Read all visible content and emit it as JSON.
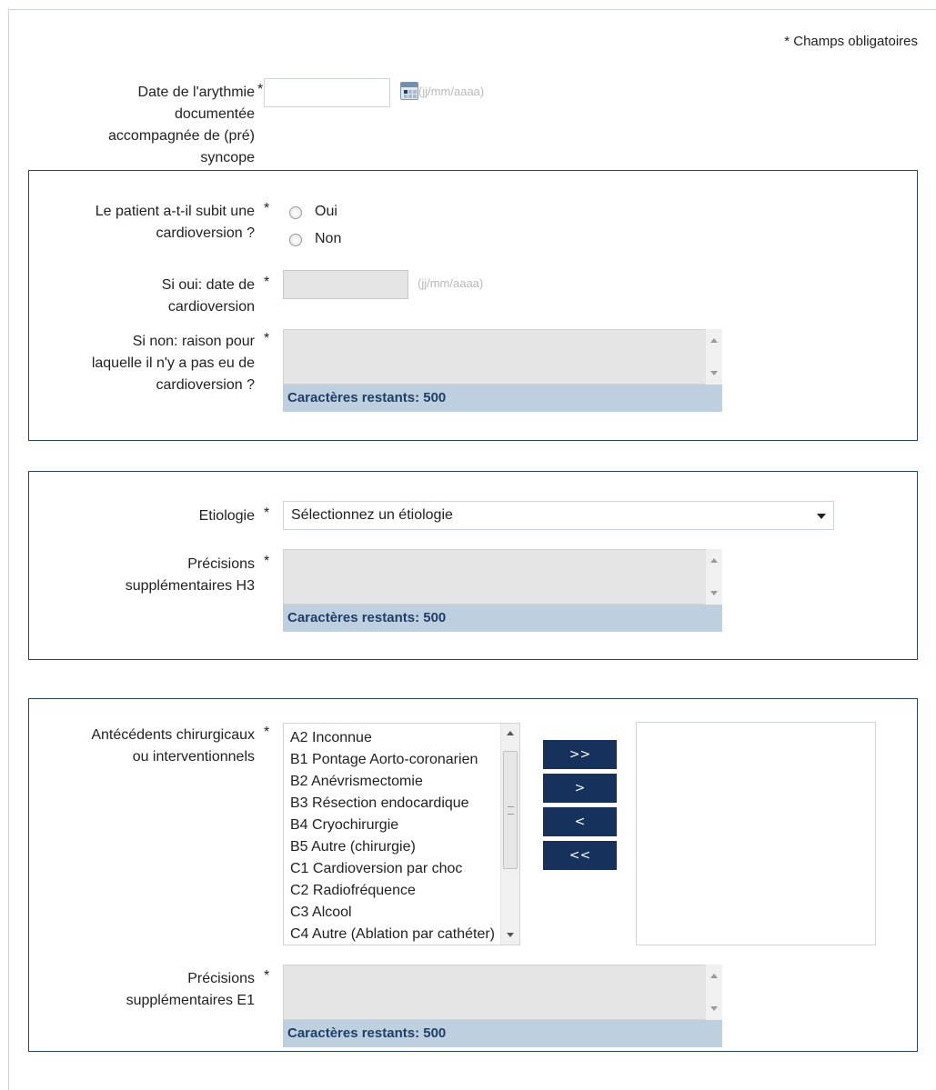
{
  "required_note": "* Champs obligatoires",
  "date_format_hint": "(jj/mm/aaaa)",
  "chars_remaining": "Caractères restants: 500",
  "arrhythmia_date": {
    "label_lines": [
      "Date de l'arythmie",
      "documentée",
      "accompagnée de (pré)",
      "syncope"
    ],
    "value": ""
  },
  "cardioversion": {
    "question_lines": [
      "Le patient a-t-il subit une",
      "cardioversion ?"
    ],
    "options": [
      "Oui",
      "Non"
    ],
    "date_label_lines": [
      "Si oui: date de",
      "cardioversion"
    ],
    "reason_label_lines": [
      "Si non: raison pour",
      "laquelle il n'y a pas eu de",
      "cardioversion ?"
    ]
  },
  "etiology": {
    "label": "Etiologie",
    "selected": "Sélectionnez un étiologie",
    "details_label_lines": [
      "Précisions",
      "supplémentaires H3"
    ]
  },
  "surgical_history": {
    "label_lines": [
      "Antécédents chirurgicaux",
      "ou interventionnels"
    ],
    "options": [
      "A2 Inconnue",
      "B1 Pontage Aorto-coronarien",
      "B2 Anévrismectomie",
      "B3 Résection endocardique",
      "B4 Cryochirurgie",
      "B5 Autre (chirurgie)",
      "C1 Cardioversion par choc",
      "C2 Radiofréquence",
      "C3 Alcool",
      "C4 Autre (Ablation par cathéter)"
    ],
    "buttons": {
      "add_all": ">>",
      "add": ">",
      "remove": "<",
      "remove_all": "<<"
    },
    "details_label_lines": [
      "Précisions",
      "supplémentaires E1"
    ]
  }
}
